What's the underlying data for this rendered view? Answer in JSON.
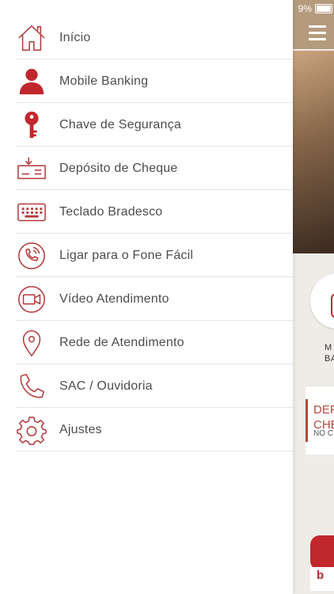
{
  "status_bar": {
    "battery_text": "9%"
  },
  "menu": {
    "items": [
      {
        "id": "inicio",
        "label": "Início",
        "icon": "home-icon"
      },
      {
        "id": "mobile-banking",
        "label": "Mobile Banking",
        "icon": "user-icon"
      },
      {
        "id": "chave-seguranca",
        "label": "Chave de Segurança",
        "icon": "key-icon"
      },
      {
        "id": "deposito-cheque",
        "label": "Depósito de Cheque",
        "icon": "check-deposit-icon"
      },
      {
        "id": "teclado-bradesco",
        "label": "Teclado Bradesco",
        "icon": "keyboard-icon"
      },
      {
        "id": "fone-facil",
        "label": "Ligar para o Fone Fácil",
        "icon": "phone-circle-icon"
      },
      {
        "id": "video-atendimento",
        "label": "Vídeo Atendimento",
        "icon": "video-camera-icon"
      },
      {
        "id": "rede-atendimento",
        "label": "Rede de Atendimento",
        "icon": "location-pin-icon"
      },
      {
        "id": "sac-ouvidoria",
        "label": "SAC / Ouvidoria",
        "icon": "phone-icon"
      },
      {
        "id": "ajustes",
        "label": "Ajustes",
        "icon": "gear-icon"
      }
    ]
  },
  "background_app": {
    "shortcut_label_line1": "M",
    "shortcut_label_line2": "BA",
    "card_title_line1": "DEP",
    "card_title_line2": "CHE",
    "card_subtitle": "NO C",
    "logo_text": "b"
  },
  "colors": {
    "brand_red": "#c0282d",
    "icon_outline_red": "#b5373a",
    "label_gray": "#4d4d4d",
    "divider": "#e4e4e4",
    "header_tan": "#b59b7e"
  }
}
